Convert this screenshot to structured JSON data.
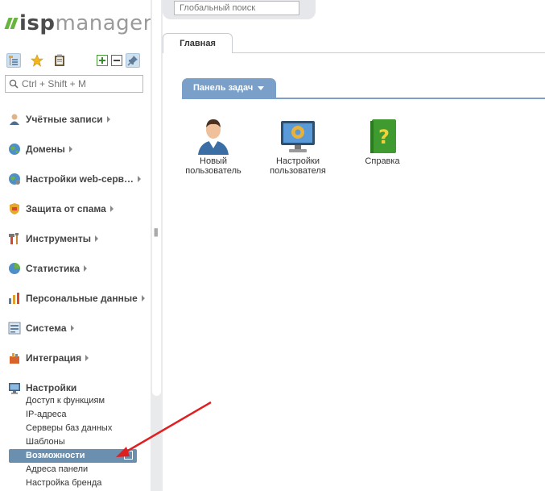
{
  "logo": {
    "isp": "isp",
    "manager": "manager"
  },
  "toolbar": {
    "icons": [
      "tree-view-icon",
      "favorites-star-icon",
      "clipboard-icon",
      "expand-all-icon",
      "collapse-all-icon",
      "pin-icon"
    ]
  },
  "sidebar_search": {
    "placeholder": "Ctrl + Shift + M"
  },
  "menu": [
    {
      "label": "Учётные записи",
      "icon": "user-accounts-icon"
    },
    {
      "label": "Домены",
      "icon": "domains-icon"
    },
    {
      "label": "Настройки web-серв…",
      "icon": "web-settings-icon"
    },
    {
      "label": "Защита от спама",
      "icon": "spam-protection-icon"
    },
    {
      "label": "Инструменты",
      "icon": "tools-icon"
    },
    {
      "label": "Статистика",
      "icon": "statistics-icon"
    },
    {
      "label": "Персональные данные",
      "icon": "personal-data-icon"
    },
    {
      "label": "Система",
      "icon": "system-icon"
    },
    {
      "label": "Интеграция",
      "icon": "integration-icon"
    },
    {
      "label": "Настройки",
      "icon": "settings-icon"
    }
  ],
  "settings_sub": [
    "Доступ к функциям",
    "IP-адреса",
    "Серверы баз данных",
    "Шаблоны",
    "Возможности",
    "Адреса панели",
    "Настройка бренда"
  ],
  "selected_sub": "Возможности",
  "global_search": {
    "placeholder": "Глобальный поиск"
  },
  "tab": {
    "label": "Главная"
  },
  "panel": {
    "title": "Панель задач"
  },
  "tiles": [
    {
      "line1": "Новый",
      "line2": "пользователь",
      "icon": "new-user-icon"
    },
    {
      "line1": "Настройки",
      "line2": "пользователя",
      "icon": "user-settings-icon"
    },
    {
      "line1": "Справка",
      "line2": "",
      "icon": "help-book-icon"
    }
  ],
  "colors": {
    "accent": "#7aa0c9",
    "selected": "#6b8fae",
    "logo_green": "#69b43f",
    "annotation_arrow": "#e02020"
  }
}
